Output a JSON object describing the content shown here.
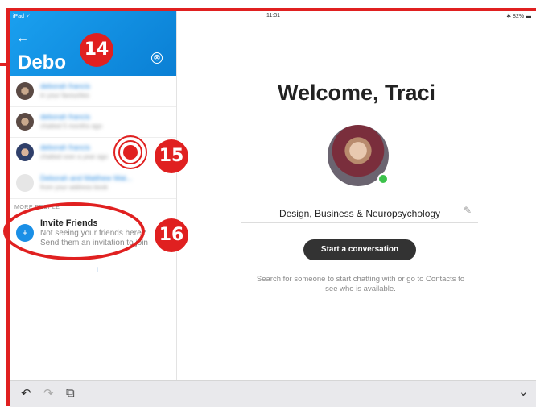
{
  "status_bar": {
    "left": "iPad ✓",
    "time": "11:31",
    "right": "✱ 82% ▬"
  },
  "sidebar": {
    "back_icon": "←",
    "search_text": "Debo",
    "clear_icon": "⊗",
    "results": [
      {
        "name": "deborah francis",
        "subtitle": "in your favourites"
      },
      {
        "name": "deborah francis",
        "subtitle": "chatted 5 months ago"
      },
      {
        "name": "deborah francis",
        "subtitle": "chatted over a year ago"
      },
      {
        "name": "Deborah and Matthew Wat...",
        "subtitle": "from your address book"
      }
    ],
    "section_label": "MORE PEOPLE",
    "invite": {
      "icon": "+",
      "title": "Invite Friends",
      "line1": "Not seeing your friends here?",
      "line2": "Send them an invitation to join"
    },
    "page_marker": "i"
  },
  "main": {
    "welcome": "Welcome, Traci",
    "mood": "Design, Business & Neuropsychology",
    "pencil_icon": "✎",
    "start_button": "Start a conversation",
    "hint": "Search for someone to start chatting with or go to Contacts to see who is available."
  },
  "toolbar": {
    "undo": "↶",
    "redo": "↷",
    "paste": "⧉",
    "chevron": "⌄"
  },
  "callouts": {
    "a": "14",
    "b": "15",
    "c": "16"
  },
  "colors": {
    "accent": "#1a8fe6",
    "callout": "#e02020"
  }
}
